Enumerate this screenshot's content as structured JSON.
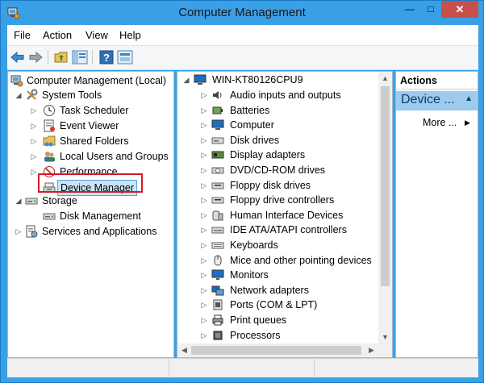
{
  "window": {
    "title": "Computer Management",
    "controls": {
      "minimize": "—",
      "maximize": "□",
      "close": "✕"
    }
  },
  "menubar": [
    "File",
    "Action",
    "View",
    "Help"
  ],
  "toolbar": [
    "back-arrow-icon",
    "forward-arrow-icon",
    "up-folder-icon",
    "show-hide-tree-icon",
    "help-icon",
    "properties-icon"
  ],
  "tree": {
    "root": "Computer Management (Local)",
    "system_tools": "System Tools",
    "system_tools_children": [
      "Task Scheduler",
      "Event Viewer",
      "Shared Folders",
      "Local Users and Groups",
      "Performance",
      "Device Manager"
    ],
    "storage": "Storage",
    "storage_children": [
      "Disk Management"
    ],
    "services": "Services and Applications",
    "selected": "Device Manager"
  },
  "devices": {
    "computer_name": "WIN-KT80126CPU9",
    "items": [
      "Audio inputs and outputs",
      "Batteries",
      "Computer",
      "Disk drives",
      "Display adapters",
      "DVD/CD-ROM drives",
      "Floppy disk drives",
      "Floppy drive controllers",
      "Human Interface Devices",
      "IDE ATA/ATAPI controllers",
      "Keyboards",
      "Mice and other pointing devices",
      "Monitors",
      "Network adapters",
      "Ports (COM & LPT)",
      "Print queues",
      "Processors"
    ]
  },
  "actions": {
    "header": "Actions",
    "section": "Device ...",
    "more": "More ..."
  },
  "colors": {
    "accent": "#3aa0e6",
    "highlight": "#d21a2b",
    "selection": "#cce4f7"
  }
}
